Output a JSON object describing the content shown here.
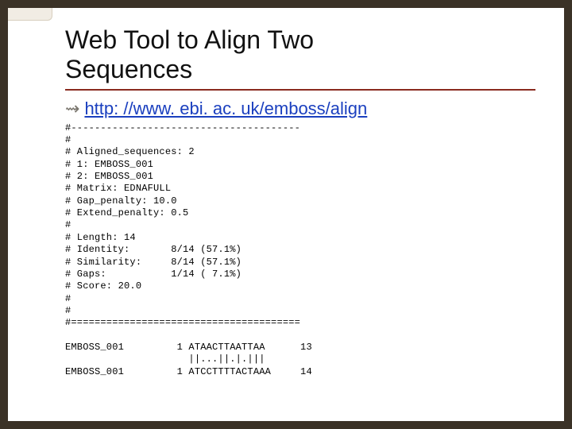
{
  "title": "Web Tool to Align Two\nSequences",
  "link": {
    "text": "http: //www. ebi. ac. uk/emboss/align"
  },
  "emboss": {
    "header_rule": "#---------------------------------------",
    "blank": "#",
    "aligned_seqs": "# Aligned_sequences: 2",
    "seq1": "# 1: EMBOSS_001",
    "seq2": "# 2: EMBOSS_001",
    "matrix": "# Matrix: EDNAFULL",
    "gap_penalty": "# Gap_penalty: 10.0",
    "extend_pen": "# Extend_penalty: 0.5",
    "length": "# Length: 14",
    "identity": "# Identity:       8/14 (57.1%)",
    "similarity": "# Similarity:     8/14 (57.1%)",
    "gaps": "# Gaps:           1/14 ( 7.1%)",
    "score": "# Score: 20.0",
    "footer_rule": "#=======================================",
    "aln_q": "EMBOSS_001         1 ATAACTTAATTAA      13",
    "aln_m": "                     ||...||.|.|||",
    "aln_s": "EMBOSS_001         1 ATCCTTTTACTAAA     14"
  }
}
